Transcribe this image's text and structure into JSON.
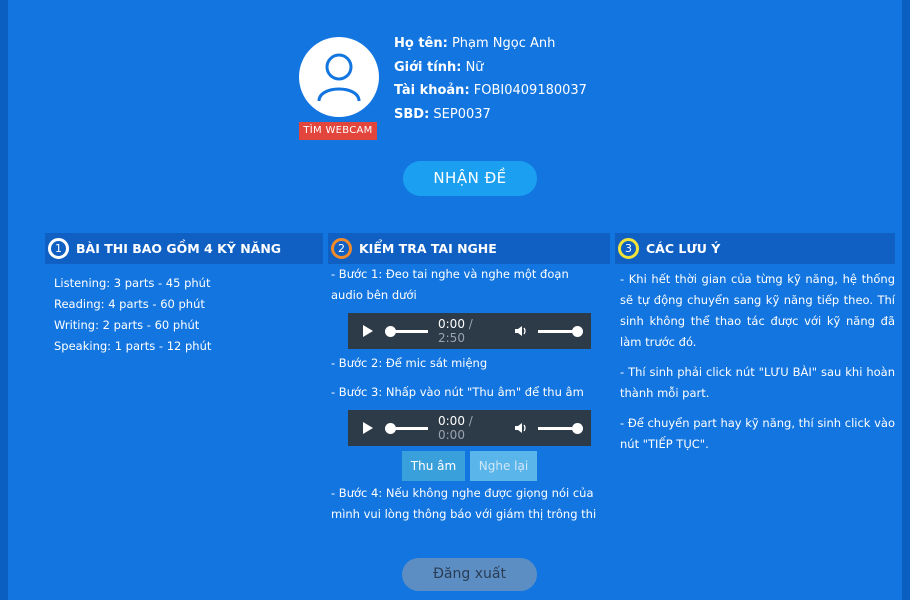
{
  "profile": {
    "name_label": "Họ tên:",
    "name_value": "Phạm Ngọc Anh",
    "gender_label": "Giới tính:",
    "gender_value": "Nữ",
    "account_label": "Tài khoản:",
    "account_value": "FOBI0409180037",
    "sbd_label": "SBD:",
    "sbd_value": "SEP0037",
    "webcam_button": "TÌM WEBCAM"
  },
  "receive_button": "NHẬN ĐỀ",
  "section1": {
    "number": "1",
    "title": "BÀI THI BAO GỒM 4 KỸ NĂNG",
    "items": [
      "Listening: 3 parts - 45 phút",
      "Reading: 4 parts - 60 phút",
      "Writing: 2 parts - 60 phút",
      "Speaking: 1 parts - 12 phút"
    ]
  },
  "section2": {
    "number": "2",
    "title": "KIỂM TRA TAI NGHE",
    "step1": "- Bước 1: Đeo tai nghe và nghe một đoạn audio bên dưới",
    "step2": "- Bước 2: Để mic sát miệng",
    "step3": "- Bước 3: Nhấp vào nút \"Thu âm\" để thu âm",
    "step4": "- Bước 4: Nếu không nghe được giọng nói của mình vui lòng thông báo với giám thị trông thi",
    "player1": {
      "current": "0:00",
      "separator": " / ",
      "duration": "2:50"
    },
    "player2": {
      "current": "0:00",
      "separator": " / ",
      "duration": "0:00"
    },
    "record_button": "Thu âm",
    "replay_button": "Nghe lại"
  },
  "section3": {
    "number": "3",
    "title": "CÁC LƯU Ý",
    "notes": [
      "- Khi hết thời gian của từng kỹ năng, hệ thống sẽ tự động chuyển sang kỹ năng tiếp theo. Thí sinh không thể thao tác được với kỹ năng đã làm trước đó.",
      "- Thí sinh phải click nút \"LƯU BÀI\" sau khi hoàn thành mỗi part.",
      "- Để chuyển part hay kỹ năng, thí sinh click vào nút \"TIẾP TỤC\"."
    ]
  },
  "logout_button": "Đăng xuất",
  "colors": {
    "background": "#1275e0",
    "accent": "#1ba0f1",
    "webcam": "#e2453c"
  }
}
